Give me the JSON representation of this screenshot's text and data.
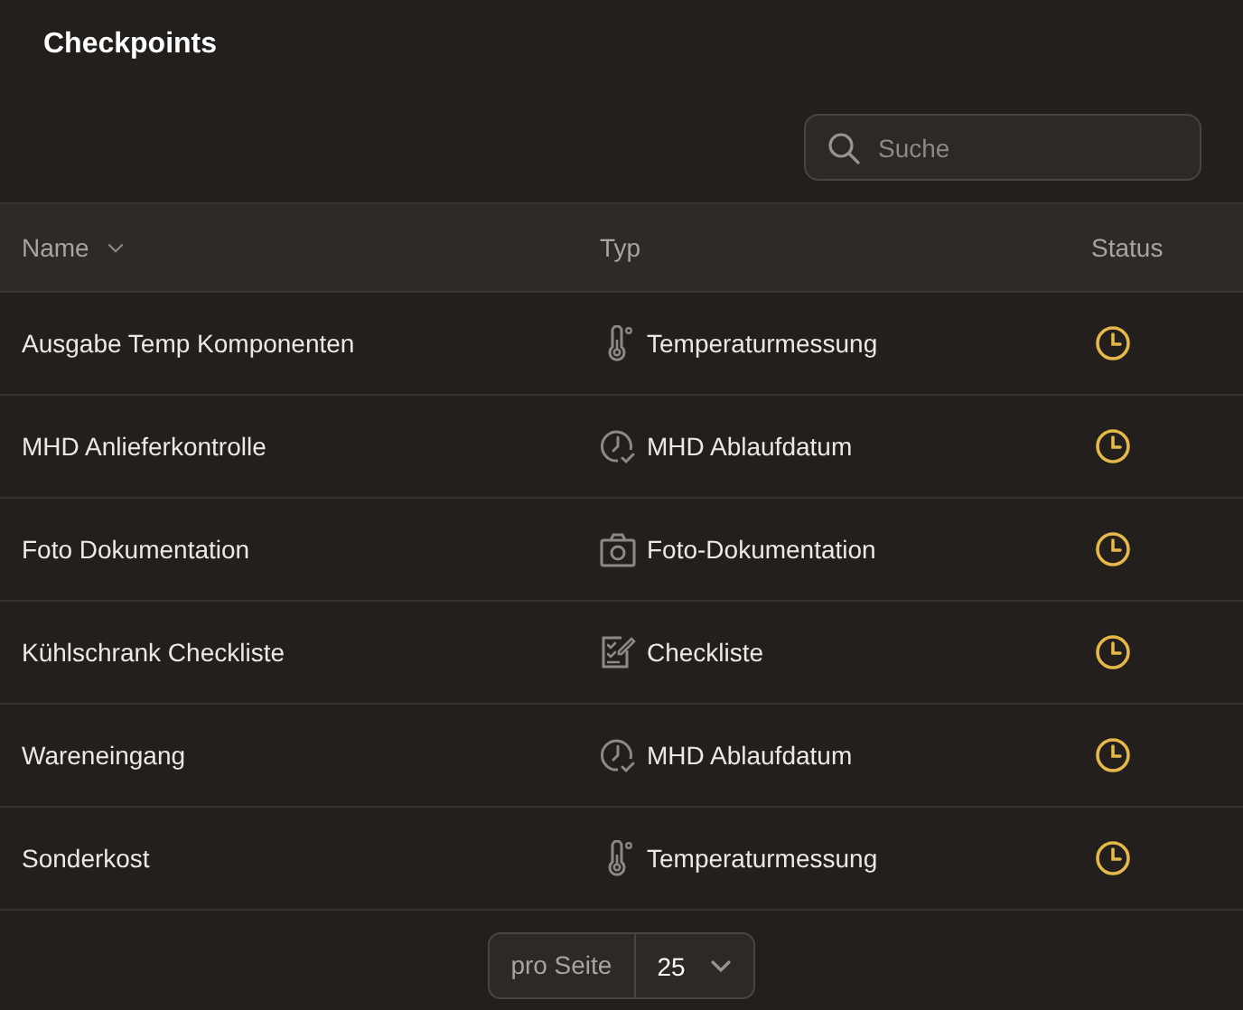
{
  "page": {
    "title": "Checkpoints"
  },
  "search": {
    "placeholder": "Suche"
  },
  "table": {
    "columns": [
      {
        "label": "Name",
        "kind": "sortable"
      },
      {
        "label": "Typ",
        "kind": "plain"
      },
      {
        "label": "Status",
        "kind": "plain"
      }
    ],
    "rows": [
      {
        "name": "Ausgabe Temp Komponenten",
        "type": {
          "kind": "temperature",
          "label": "Temperaturmessung"
        },
        "status": {
          "kind": "pending"
        }
      },
      {
        "name": "MHD Anlieferkontrolle",
        "type": {
          "kind": "expiry",
          "label": "MHD Ablaufdatum"
        },
        "status": {
          "kind": "pending"
        }
      },
      {
        "name": "Foto Dokumentation",
        "type": {
          "kind": "photo",
          "label": "Foto-Dokumentation"
        },
        "status": {
          "kind": "pending"
        }
      },
      {
        "name": "Kühlschrank Checkliste",
        "type": {
          "kind": "checklist",
          "label": "Checkliste"
        },
        "status": {
          "kind": "pending"
        }
      },
      {
        "name": "Wareneingang",
        "type": {
          "kind": "expiry",
          "label": "MHD Ablaufdatum"
        },
        "status": {
          "kind": "pending"
        }
      },
      {
        "name": "Sonderkost",
        "type": {
          "kind": "temperature",
          "label": "Temperaturmessung"
        },
        "status": {
          "kind": "pending"
        }
      }
    ]
  },
  "pagination": {
    "label": "pro Seite",
    "value": "25"
  }
}
